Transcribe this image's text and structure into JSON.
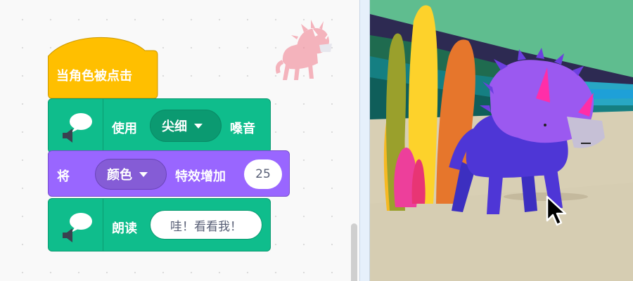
{
  "workspace": {
    "hat_block": {
      "label": "当角色被点击",
      "color": "#ffbf00"
    },
    "speak_voice_block": {
      "prefix": "使用",
      "voice_value": "尖细",
      "suffix": "嗓音",
      "icon": "speech-bubble-speaker-icon",
      "color": "#0fbd8c"
    },
    "effect_block": {
      "prefix": "将",
      "effect_value": "颜色",
      "middle": "特效增加",
      "amount": "25",
      "color": "#9966ff"
    },
    "speak_text_block": {
      "prefix": "朗读",
      "text_value": "哇！看看我！",
      "icon": "speech-bubble-speaker-icon",
      "color": "#0fbd8c"
    },
    "sprite_thumbnail": "triceratops-sprite-icon"
  },
  "stage": {
    "backdrop": "jungle-backdrop",
    "sprite": "purple-triceratops",
    "cursor": "mouse-pointer-icon"
  }
}
